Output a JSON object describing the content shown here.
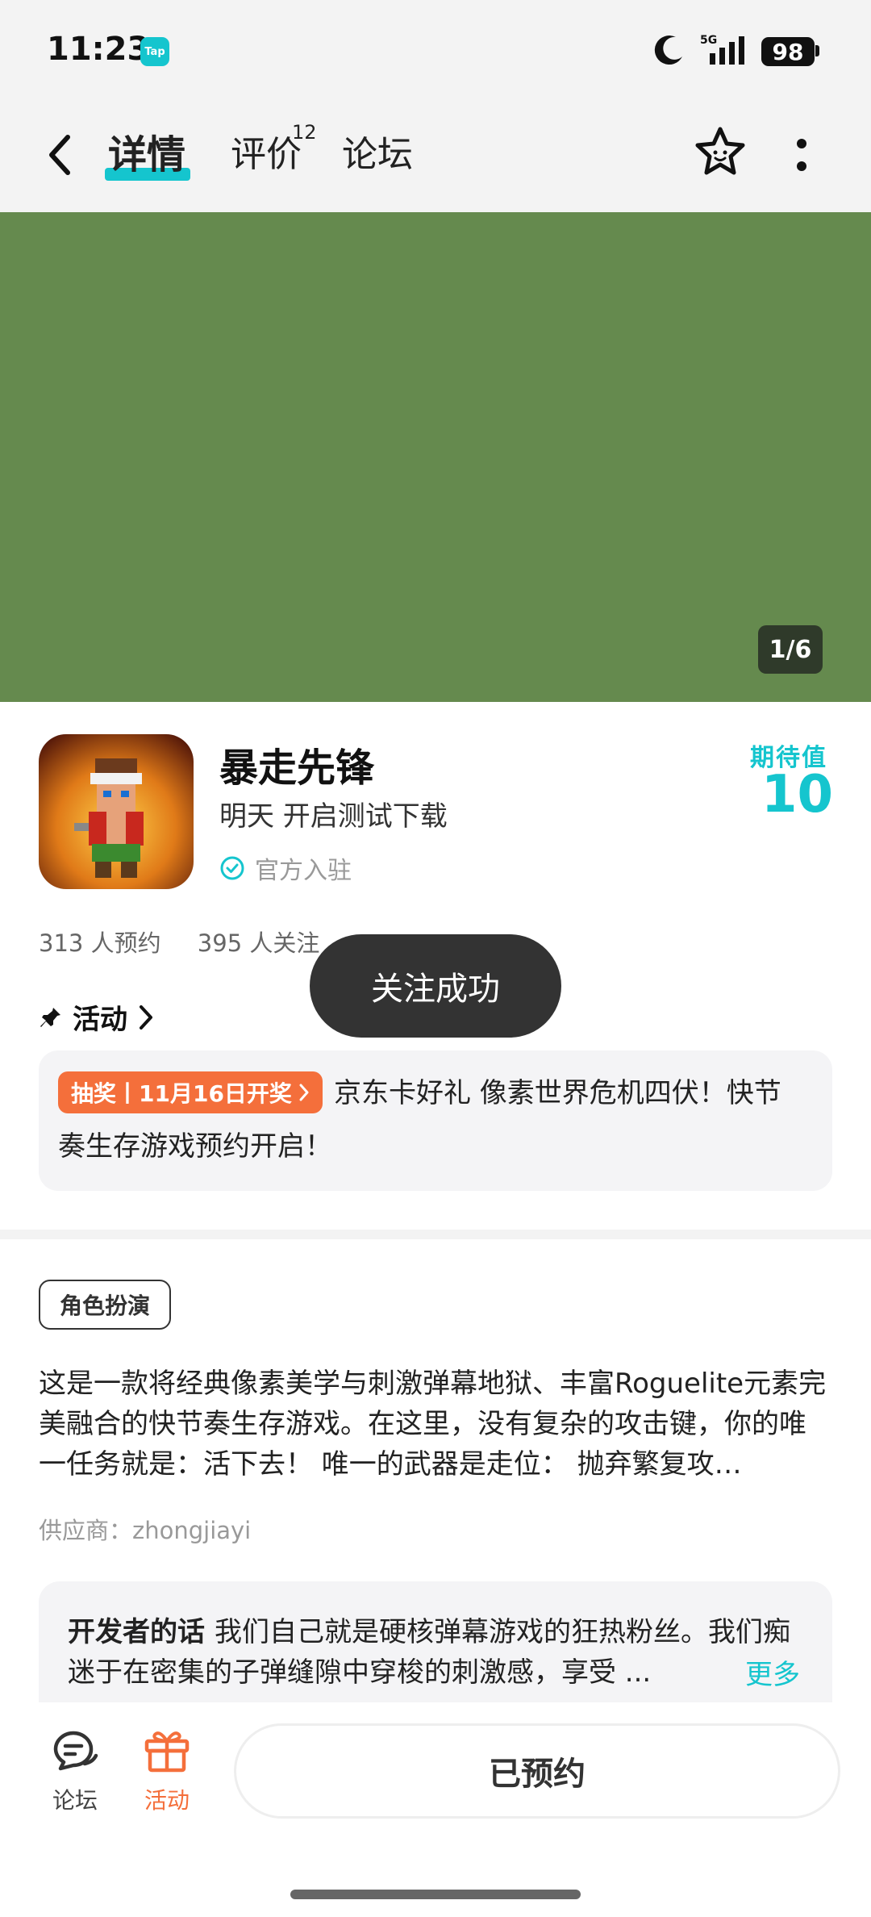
{
  "status_bar": {
    "time": "11:23",
    "app_badge": "Tap",
    "network": "5G",
    "battery": "98"
  },
  "header": {
    "tabs": [
      {
        "label": "详情",
        "active": true
      },
      {
        "label": "评价",
        "count": "12"
      },
      {
        "label": "论坛"
      }
    ],
    "icons": [
      "back-icon",
      "star-face-icon",
      "more-vertical-icon"
    ]
  },
  "media": {
    "pager": "1/6",
    "color": "#658a4e"
  },
  "game": {
    "title": "暴走先锋",
    "subtitle": "明天 开启测试下载",
    "official_label": "官方入驻",
    "expect_label": "期待值",
    "expect_value": "10",
    "reservations": "313 人预约",
    "followers": "395 人关注"
  },
  "toast": {
    "text": "关注成功"
  },
  "activity": {
    "heading": "活动",
    "tag": "抽奖丨11月16日开奖",
    "text": "京东卡好礼 像素世界危机四伏！快节奏生存游戏预约开启！"
  },
  "genre": {
    "label": "角色扮演"
  },
  "description": {
    "text": "这是一款将经典像素美学与刺激弹幕地狱、丰富Roguelite元素完美融合的快节奏生存游戏。在这里，没有复杂的攻击键，你的唯一任务就是：活下去！ 唯一的武器是走位： 抛弃繁复攻…",
    "supplier": "供应商：zhongjiayi"
  },
  "developer": {
    "label": "开发者的话",
    "text": "我们自己就是硬核弹幕游戏的狂热粉丝。我们痴迷于在密集的子弹缝隙中穿梭的刺激感，享受 ...",
    "more": "更多"
  },
  "bottom_nav": {
    "forum_label": "论坛",
    "activity_label": "活动",
    "reserve_button": "已预约"
  },
  "colors": {
    "accent": "#15c5ce",
    "orange": "#f46f3b"
  }
}
